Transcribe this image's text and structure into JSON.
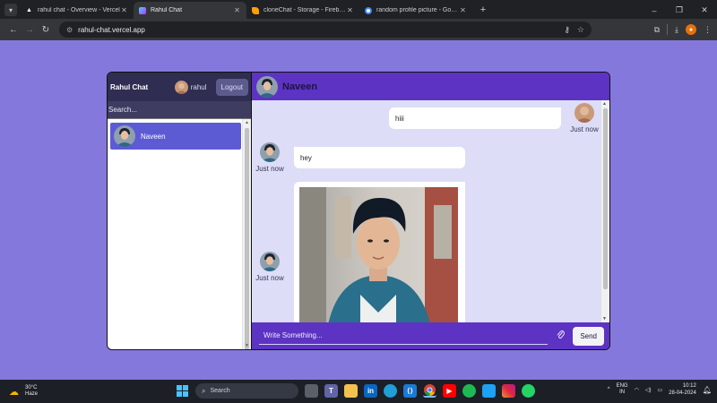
{
  "browser": {
    "tabs": [
      {
        "title": "rahul chat - Overview - Vercel",
        "icon": "vercel-icon",
        "favicon_color": "#ffffff",
        "active": false
      },
      {
        "title": "Rahul Chat",
        "icon": "vite-icon",
        "favicon_color": "#9c6cff",
        "active": true
      },
      {
        "title": "cloneChat - Storage - Firebase",
        "icon": "firebase-icon",
        "favicon_color": "#ffa000",
        "active": false
      },
      {
        "title": "random profile picture - Google",
        "icon": "google-icon",
        "favicon_color": "#4285f4",
        "active": false
      }
    ],
    "url": "rahul-chat.vercel.app"
  },
  "app": {
    "brand": "Rahul Chat",
    "current_user": "rahul",
    "logout_label": "Logout",
    "search_placeholder": "Search...",
    "chats": [
      {
        "name": "Naveen",
        "selected": true
      }
    ],
    "active_chat": {
      "name": "Naveen",
      "messages": [
        {
          "from": "me",
          "type": "text",
          "text": "hiii",
          "time": "Just now"
        },
        {
          "from": "other",
          "type": "text",
          "text": "hey",
          "time": "Just now"
        },
        {
          "from": "other",
          "type": "image",
          "time": "Just now"
        }
      ]
    },
    "input_placeholder": "Write Something...",
    "send_label": "Send"
  },
  "taskbar": {
    "weather_temp": "30°C",
    "weather_desc": "Haze",
    "search_label": "Search",
    "lang_line1": "ENG",
    "lang_line2": "IN",
    "time": "10:12",
    "date": "28-04-2024"
  },
  "colors": {
    "page_bg": "#8478dc",
    "sidebar_bg": "#3e3c61",
    "chat_header_bg": "#5d33c4",
    "messages_bg": "#ddddf7",
    "selected_chat_bg": "#5d5bd4"
  }
}
